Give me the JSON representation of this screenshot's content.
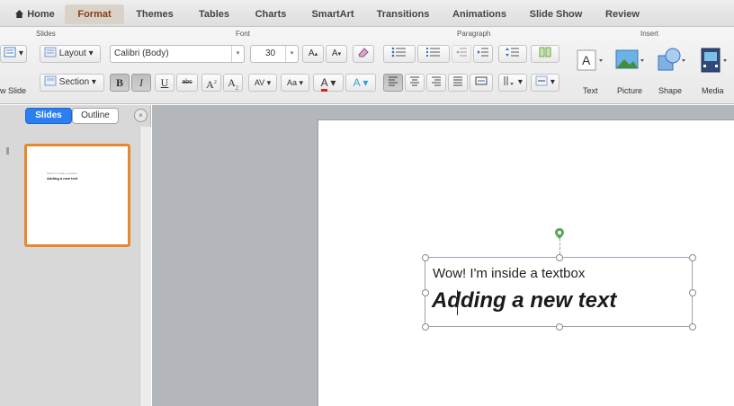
{
  "tabs": [
    {
      "label": "Home",
      "icon": "home-icon"
    },
    {
      "label": "Format",
      "active": true
    },
    {
      "label": "Themes"
    },
    {
      "label": "Tables"
    },
    {
      "label": "Charts"
    },
    {
      "label": "SmartArt"
    },
    {
      "label": "Transitions"
    },
    {
      "label": "Animations"
    },
    {
      "label": "Slide Show"
    },
    {
      "label": "Review"
    }
  ],
  "ribbon": {
    "groups": {
      "slides": "Slides",
      "font": "Font",
      "paragraph": "Paragraph",
      "insert": "Insert"
    },
    "slides": {
      "layout_label": "Layout",
      "section_label": "Section",
      "new_slide_label": "w Slide"
    },
    "font": {
      "family": "Calibri (Body)",
      "size": "30",
      "grow": "A",
      "shrink": "A",
      "bold": "B",
      "italic": "I",
      "underline": "U",
      "strike": "abc",
      "superscript": "A",
      "subscript": "A",
      "spacing": "AV",
      "change_case": "Aa",
      "font_color": "A",
      "highlight": "A"
    },
    "insert": {
      "text_label": "Text",
      "picture_label": "Picture",
      "shape_label": "Shape",
      "media_label": "Media"
    }
  },
  "left_panel": {
    "slides_tab": "Slides",
    "outline_tab": "Outline",
    "close": "×"
  },
  "thumbnail": {
    "line1": "Wow! I'm inside a textbox",
    "line2": "Adding a new text"
  },
  "textbox": {
    "line1": "Wow! I'm inside a textbox",
    "line2": "Adding a new text"
  },
  "colors": {
    "active_tab": "#d9d2c8",
    "active_tab_text": "#8a3b18",
    "slides_tab_active": "#2c7ff0",
    "thumbnail_border": "#e58a2c",
    "rotation_handle": "#5aa85a",
    "canvas_bg": "#b3b6bb"
  }
}
